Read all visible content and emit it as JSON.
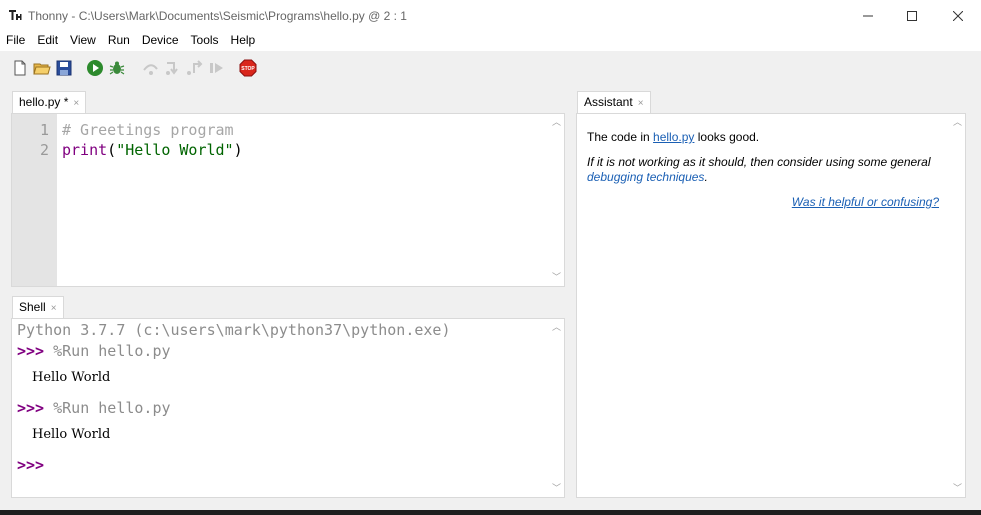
{
  "window": {
    "title": "Thonny  -  C:\\Users\\Mark\\Documents\\Seismic\\Programs\\hello.py  @  2 : 1",
    "minimize": "—",
    "maximize": "☐",
    "close": "✕"
  },
  "menu": [
    "File",
    "Edit",
    "View",
    "Run",
    "Device",
    "Tools",
    "Help"
  ],
  "toolbar": {
    "icons": [
      "new-file-icon",
      "open-folder-icon",
      "save-icon",
      "run-icon",
      "debug-icon",
      "step-over-icon",
      "step-into-icon",
      "step-out-icon",
      "resume-icon",
      "stop-icon"
    ],
    "stop_label": "STOP"
  },
  "editor": {
    "tab_label": "hello.py *",
    "tab_close": "×",
    "line_numbers": [
      "1",
      "2"
    ],
    "lines": {
      "line1": "# Greetings program",
      "line2_fn": "print",
      "line2_open": "(",
      "line2_str": "\"Hello World\"",
      "line2_close": ")"
    }
  },
  "shell": {
    "tab_label": "Shell",
    "tab_close": "×",
    "header": "Python 3.7.7 (c:\\users\\mark\\python37\\python.exe)",
    "prompt": ">>>",
    "cmd1": " %Run hello.py",
    "out1": "Hello World",
    "cmd2": " %Run hello.py",
    "out2": "Hello World",
    "prompt_final": ">>>"
  },
  "assistant": {
    "tab_label": "Assistant",
    "tab_close": "×",
    "msg_prefix": "The code in ",
    "msg_link": "hello.py",
    "msg_suffix": " looks good.",
    "advice_line1": "If it is not working as it should, then consider using some general",
    "advice_link": "debugging techniques",
    "advice_end": ".",
    "feedback_link": "Was it helpful or confusing?"
  },
  "colors": {
    "keyword_purple": "#800080",
    "string_green": "#006400",
    "comment_gray": "#a6a6a6",
    "link_blue": "#1a5fb4",
    "run_green": "#2d8a2d",
    "stop_red": "#d9261c"
  }
}
